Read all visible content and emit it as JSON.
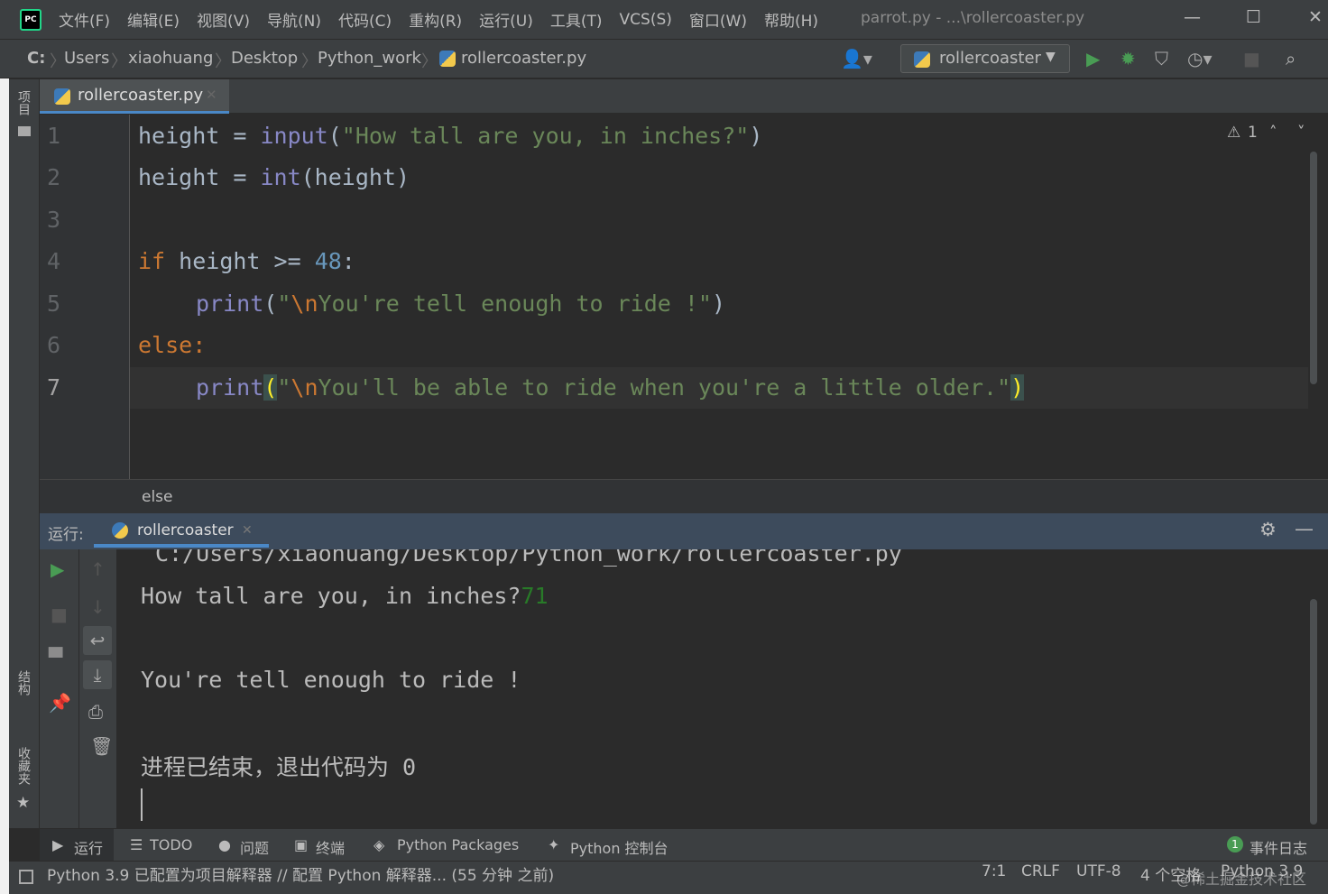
{
  "menubar": {
    "logo": "PC",
    "items": [
      "文件(F)",
      "编辑(E)",
      "视图(V)",
      "导航(N)",
      "代码(C)",
      "重构(R)",
      "运行(U)",
      "工具(T)",
      "VCS(S)",
      "窗口(W)",
      "帮助(H)"
    ],
    "window_title": "parrot.py - ...\\rollercoaster.py"
  },
  "navbar": {
    "crumbs": [
      "C:",
      "Users",
      "xiaohuang",
      "Desktop",
      "Python_work",
      "rollercoaster.py"
    ],
    "run_config": "rollercoaster"
  },
  "left_strip": {
    "project": "项目",
    "structure": "结构",
    "favorites": "收藏夹"
  },
  "editor": {
    "tab_label": "rollercoaster.py",
    "warning_count": "1",
    "line_numbers": [
      "1",
      "2",
      "3",
      "4",
      "5",
      "6",
      "7"
    ],
    "breadcrumb": "else",
    "code": {
      "l1_a": "height",
      "l1_b": " = ",
      "l1_fn": "input",
      "l1_c": "(",
      "l1_str": "\"How tall are you, in inches?\"",
      "l1_d": ")",
      "l2_a": "height",
      "l2_b": " = ",
      "l2_fn": "int",
      "l2_c": "(height)",
      "l4_kw": "if",
      "l4_a": " height >= ",
      "l4_num": "48",
      "l4_b": ":",
      "l5_fn": "print",
      "l5_a": "(",
      "l5_q": "\"",
      "l5_esc": "\\n",
      "l5_str": "You're tell enough to ride !\"",
      "l5_b": ")",
      "l6_kw": "else",
      "l6_a": ":",
      "l7_fn": "print",
      "l7_a": "(",
      "l7_q": "\"",
      "l7_esc": "\\n",
      "l7_str": "You'll be able to ride when you're a little older.\"",
      "l7_b": ")"
    }
  },
  "run_panel": {
    "label": "运行:",
    "tab_label": "rollercoaster",
    "console": {
      "path_line": "C:/Users/xiaohuang/Desktop/Python_work/rollercoaster.py",
      "prompt": "How tall are you, in inches?",
      "input_value": "71",
      "output": "You're tell enough to ride !",
      "exit_message": "进程已结束，退出代码为 0"
    }
  },
  "tool_windows": {
    "run": "运行",
    "todo": "TODO",
    "problems": "问题",
    "terminal": "终端",
    "python_packages": "Python Packages",
    "python_console": "Python 控制台",
    "event_log_badge": "1",
    "event_log": "事件日志"
  },
  "status_bar": {
    "message": "Python 3.9 已配置为项目解释器 // 配置 Python 解释器... (55 分钟 之前)",
    "position": "7:1",
    "line_ending": "CRLF",
    "encoding": "UTF-8",
    "indent": "4 个空格",
    "interpreter": "Python 3.9",
    "watermark": "@稀土掘金技术社区"
  },
  "colors": {
    "background": "#2b2b2b",
    "panel": "#3c3f41",
    "keyword": "#cc7832",
    "builtin": "#8888c6",
    "string": "#6a8759",
    "number": "#6897bb",
    "run_green": "#499c54",
    "input_green": "#287a28"
  }
}
